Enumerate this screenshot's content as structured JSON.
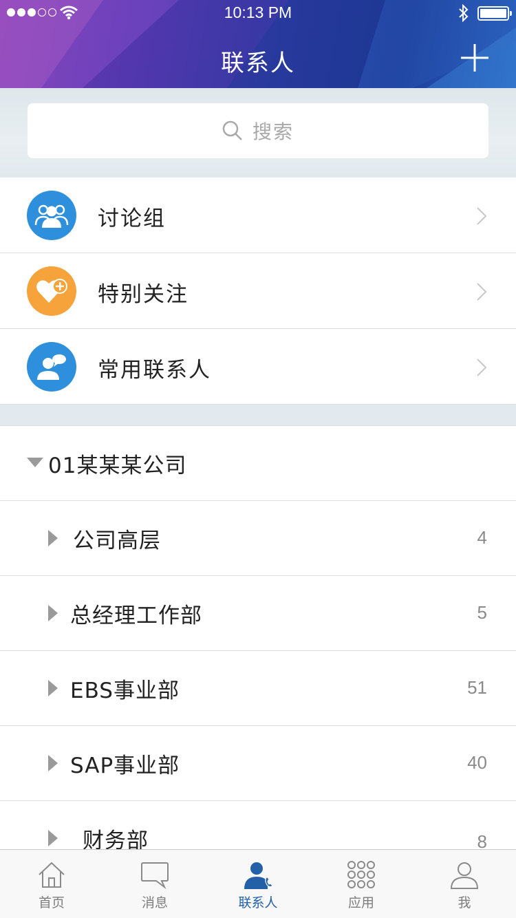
{
  "status": {
    "time": "10:13 PM"
  },
  "header": {
    "title": "联系人"
  },
  "search": {
    "placeholder": "搜索"
  },
  "quick_items": [
    {
      "label": "讨论组",
      "icon": "group-icon",
      "color": "#2e8fdc"
    },
    {
      "label": "特别关注",
      "icon": "heart-plus-icon",
      "color": "#f5a33a"
    },
    {
      "label": "常用联系人",
      "icon": "contact-chat-icon",
      "color": "#2e8fdc"
    }
  ],
  "company": {
    "name": "01某某某公司"
  },
  "departments": [
    {
      "name": "公司高层",
      "count": "4"
    },
    {
      "name": "总经理工作部",
      "count": "5"
    },
    {
      "name": "EBS事业部",
      "count": "51"
    },
    {
      "name": "SAP事业部",
      "count": "40"
    },
    {
      "name": "财务部",
      "count": "8"
    }
  ],
  "tabs": [
    {
      "label": "首页",
      "icon": "home-icon"
    },
    {
      "label": "消息",
      "icon": "message-icon"
    },
    {
      "label": "联系人",
      "icon": "contacts-icon",
      "active": true
    },
    {
      "label": "应用",
      "icon": "apps-grid-icon"
    },
    {
      "label": "我",
      "icon": "profile-icon"
    }
  ],
  "colors": {
    "accent": "#2460a8",
    "blue": "#2e8fdc",
    "orange": "#f5a33a"
  }
}
